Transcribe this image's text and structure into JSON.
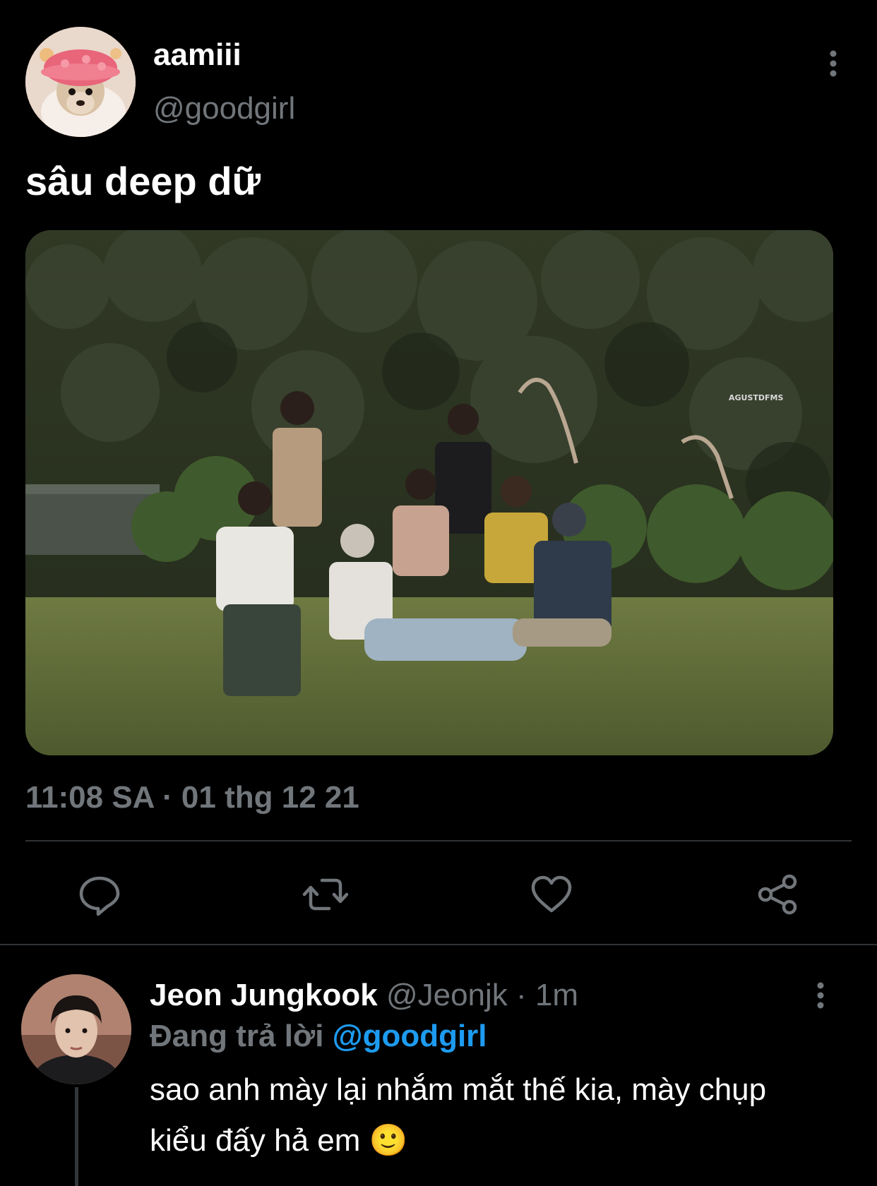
{
  "main_tweet": {
    "display_name": "aamiii",
    "handle": "@goodgirl",
    "text": "sâu deep dữ",
    "timestamp": "11:08 SA · 01 thg 12 21",
    "media_watermark": "AGUSTDFMS",
    "avatar_icon": "chihuahua-avatar",
    "more_icon": "more-vertical-icon"
  },
  "actions": [
    {
      "name": "reply",
      "icon": "comment-icon"
    },
    {
      "name": "retweet",
      "icon": "retweet-icon"
    },
    {
      "name": "like",
      "icon": "heart-icon"
    },
    {
      "name": "share",
      "icon": "share-icon"
    }
  ],
  "reply": {
    "display_name": "Jeon Jungkook",
    "handle": "@Jeonjk",
    "dot": "·",
    "time": "1m",
    "replying_label": "Đang trả lời",
    "replying_handle": "@goodgirl",
    "text": "sao anh mày lại nhắm mắt thế kia, mày chụp kiểu đấy hả em 🙂"
  },
  "colors": {
    "background": "#000000",
    "text_primary": "#ffffff",
    "text_secondary": "#71767b",
    "link": "#1d9bf0",
    "divider": "#2f3336"
  }
}
